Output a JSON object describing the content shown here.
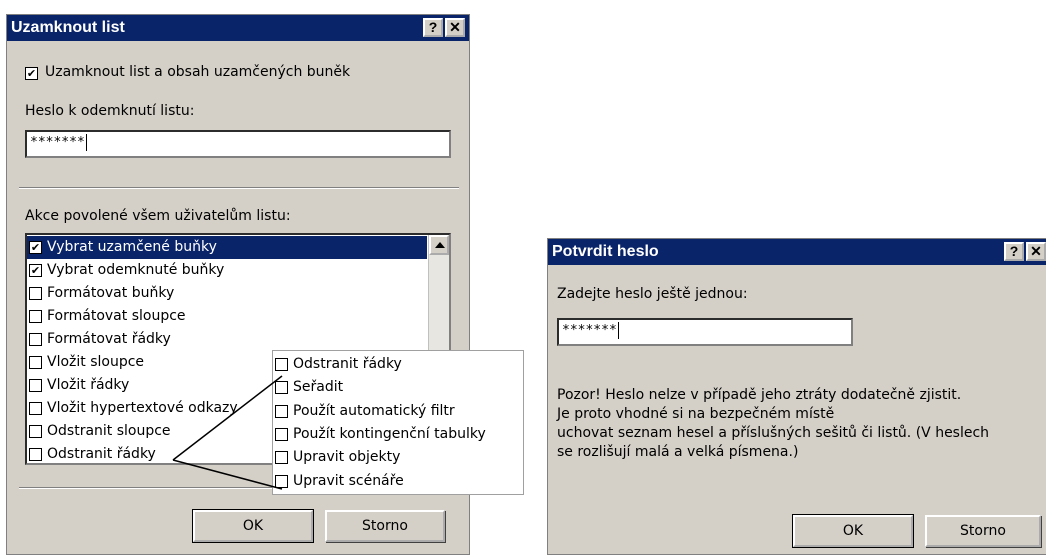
{
  "lock_dialog": {
    "title": "Uzamknout list",
    "help_btn": "?",
    "close_btn": "✕",
    "protect_checkbox_label": "Uzamknout list a obsah uzamčených buněk",
    "protect_checked": true,
    "password_label": "Heslo k odemknutí listu:",
    "password_value": "*******",
    "actions_label": "Akce povolené všem uživatelům listu:",
    "actions": [
      {
        "label": "Vybrat uzamčené buňky",
        "checked": true
      },
      {
        "label": "Vybrat odemknuté buňky",
        "checked": true
      },
      {
        "label": "Formátovat buňky",
        "checked": false
      },
      {
        "label": "Formátovat sloupce",
        "checked": false
      },
      {
        "label": "Formátovat řádky",
        "checked": false
      },
      {
        "label": "Vložit sloupce",
        "checked": false
      },
      {
        "label": "Vložit řádky",
        "checked": false
      },
      {
        "label": "Vložit hypertextové odkazy",
        "checked": false
      },
      {
        "label": "Odstranit sloupce",
        "checked": false
      },
      {
        "label": "Odstranit řádky",
        "checked": false
      }
    ],
    "extended_actions": [
      {
        "label": "Odstranit řádky",
        "checked": false
      },
      {
        "label": "Seřadit",
        "checked": false
      },
      {
        "label": "Použít automatický filtr",
        "checked": false
      },
      {
        "label": "Použít kontingenční tabulky",
        "checked": false
      },
      {
        "label": "Upravit objekty",
        "checked": false
      },
      {
        "label": "Upravit scénáře",
        "checked": false
      }
    ],
    "ok_label": "OK",
    "cancel_label": "Storno"
  },
  "confirm_dialog": {
    "title": "Potvrdit heslo",
    "help_btn": "?",
    "close_btn": "✕",
    "prompt_label": "Zadejte heslo ještě jednou:",
    "password_value": "*******",
    "warning_lines": [
      "Pozor!  Heslo nelze v případě jeho ztráty dodatečně zjistit.",
      "Je proto vhodné si na bezpečném místě",
      "uchovat seznam hesel a příslušných sešitů či listů. (V heslech",
      "se rozlišují malá a velká písmena.)"
    ],
    "ok_label": "OK",
    "cancel_label": "Storno"
  }
}
